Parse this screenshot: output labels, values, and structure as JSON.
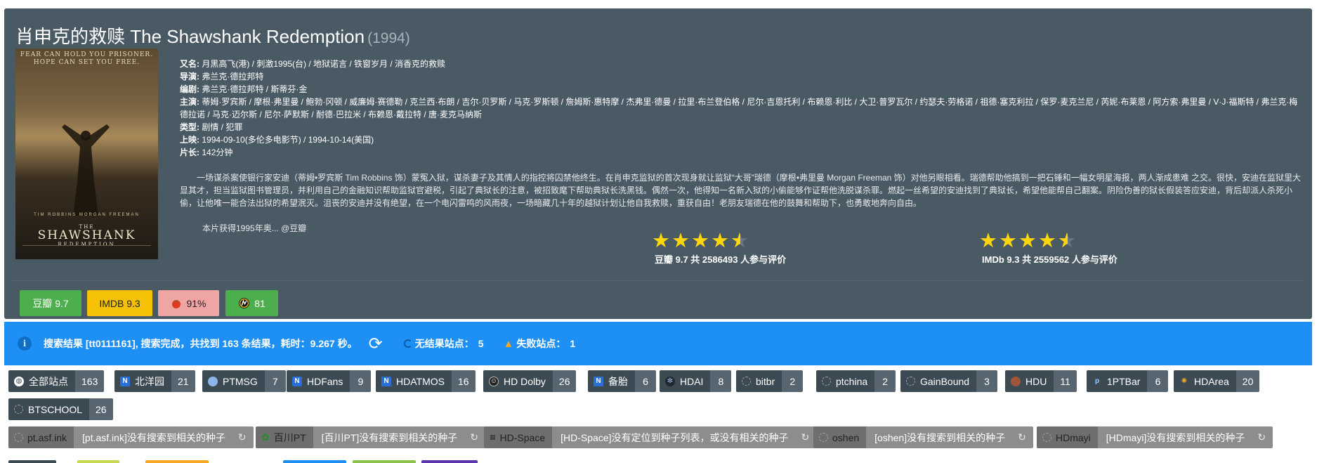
{
  "movie": {
    "title": "肖申克的救赎 The Shawshank Redemption",
    "year": "(1994)",
    "poster": {
      "tagline": "FEAR CAN HOLD YOU PRISONER. HOPE CAN SET YOU FREE.",
      "stars": "TIM ROBBINS   MORGAN FREEMAN",
      "the": "THE",
      "name": "SHAWSHANK",
      "sub": "REDEMPTION"
    },
    "info": [
      {
        "label": "又名:",
        "value": "月黑高飞(港) / 刺激1995(台) / 地狱诺言 / 铁窗岁月 / 消香克的救赎"
      },
      {
        "label": "导演:",
        "value": "弗兰克·德拉邦特"
      },
      {
        "label": "编剧:",
        "value": "弗兰克·德拉邦特 / 斯蒂芬·金"
      },
      {
        "label": "主演:",
        "value": "蒂姆·罗宾斯 / 摩根·弗里曼 / 鲍勃·冈顿 / 威廉姆·赛德勒 / 克兰西·布朗 / 吉尔·贝罗斯 / 马克·罗斯顿 / 詹姆斯·惠特摩 / 杰弗里·德曼 / 拉里·布兰登伯格 / 尼尔·吉恩托利 / 布赖恩·利比 / 大卫·普罗瓦尔 / 约瑟夫·劳格诺 / 祖德·塞克利拉 / 保罗·麦克兰尼 / 芮妮·布莱恩 / 阿方索·弗里曼 / V·J·福斯特 / 弗兰克·梅德拉诺 / 马克·迈尔斯 / 尼尔·萨默斯 / 耐德·巴拉米 / 布赖恩·戴拉特 / 唐·麦克马纳斯"
      },
      {
        "label": "类型:",
        "value": "剧情 / 犯罪"
      },
      {
        "label": "上映:",
        "value": "1994-09-10(多伦多电影节) / 1994-10-14(美国)"
      },
      {
        "label": "片长:",
        "value": "142分钟"
      }
    ],
    "synopsis": "一场谋杀案使银行家安迪（蒂姆•罗宾斯 Tim Robbins 饰）蒙冤入狱，谋杀妻子及其情人的指控将囚禁他终生。在肖申克监狱的首次现身就让监狱“大哥”瑞德（摩根•弗里曼 Morgan Freeman 饰）对他另眼相看。瑞德帮助他搞到一把石锤和一幅女明星海报，两人渐成患难 之交。很快，安迪在监狱里大显其才，担当监狱图书管理员，并利用自己的金融知识帮助监狱官避税，引起了典狱长的注意，被招致麾下帮助典狱长洗黑钱。偶然一次，他得知一名新入狱的小偷能够作证帮他洗脱谋杀罪。燃起一丝希望的安迪找到了典狱长，希望他能帮自己翻案。阴险伪善的狱长假装答应安迪，背后却派人杀死小偷，让他唯一能合法出狱的希望泯灭。沮丧的安迪并没有绝望，在一个电闪雷鸣的风雨夜，一场暗藏几十年的越狱计划让他自我救赎，重获自由！老朋友瑞德在他的鼓舞和帮助下，也勇敢地奔向自由。",
    "award": "本片获得1995年奥... @豆瓣"
  },
  "ratings": {
    "douban": "豆瓣 9.7",
    "imdb": "IMDB 9.3",
    "tomato": "91%",
    "meta": "81",
    "douban_stars": 4.5,
    "douban_summary": "豆瓣 9.7 共 2586493 人参与评价",
    "imdb_stars": 4.5,
    "imdb_summary": "IMDb 9.3 共 2559562 人参与评价"
  },
  "status": {
    "text": "搜索结果 [tt0111161], 搜索完成，共找到 163 条结果，耗时：9.267 秒。",
    "noresult": "无结果站点：",
    "noresult_count": "5",
    "failed": "失败站点：",
    "failed_count": "1"
  },
  "sites": [
    {
      "name": "全部站点",
      "count": "163",
      "icon": "globe-icon"
    },
    {
      "name": "北洋园",
      "count": "21",
      "icon": "n-logo-icon"
    },
    {
      "name": "PTMSG",
      "count": "7",
      "icon": "circle-logo-icon"
    },
    {
      "name": "HDFans",
      "count": "9",
      "icon": "n-logo-icon"
    },
    {
      "name": "HDATMOS",
      "count": "16",
      "icon": "n-logo-icon"
    },
    {
      "name": "HD Dolby",
      "count": "26",
      "icon": "face-logo-icon"
    },
    {
      "name": "备胎",
      "count": "6",
      "icon": "n-logo-icon"
    },
    {
      "name": "HDAI",
      "count": "8",
      "icon": "gear-logo-icon"
    },
    {
      "name": "bitbr",
      "count": "2",
      "icon": "ring-icon"
    },
    {
      "name": "ptchina",
      "count": "2",
      "icon": "ring-icon"
    },
    {
      "name": "GainBound",
      "count": "3",
      "icon": "ring-icon"
    },
    {
      "name": "HDU",
      "count": "11",
      "icon": "ball-logo-icon"
    },
    {
      "name": "1PTBar",
      "count": "6",
      "icon": "p-logo-icon"
    },
    {
      "name": "HDArea",
      "count": "20",
      "icon": "flame-logo-icon"
    },
    {
      "name": "BTSCHOOL",
      "count": "26",
      "icon": "ring-icon"
    }
  ],
  "failed_sites": [
    {
      "name": "pt.asf.ink",
      "message": "[pt.asf.ink]没有搜索到相关的种子"
    },
    {
      "name": "百川PT",
      "message": "[百川PT]没有搜索到相关的种子"
    },
    {
      "name": "HD-Space",
      "message": "[HD-Space]没有定位到种子列表，或没有相关的种子"
    },
    {
      "name": "oshen",
      "message": "[oshen]没有搜索到相关的种子"
    },
    {
      "name": "HDmayi",
      "message": "[HDmayi]没有搜索到相关的种子"
    }
  ],
  "colors": {
    "panel": "#4a5a65",
    "status_bar": "#1e90f5",
    "douban": "#4cae4c",
    "imdb": "#f4c106",
    "tomato": "#f0a5a5",
    "star": "#ffd60a"
  }
}
